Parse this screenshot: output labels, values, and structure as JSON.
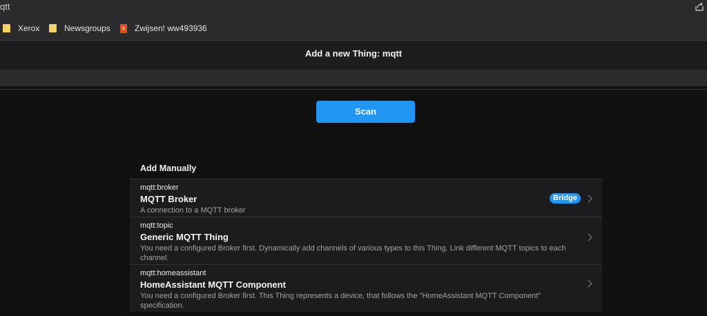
{
  "browser": {
    "url_text": "qtt",
    "share_icon": "share-icon",
    "bookmarks": [
      {
        "label": "Xerox",
        "icon": "folder-icon"
      },
      {
        "label": "Newsgroups",
        "icon": "folder-icon"
      },
      {
        "label": "Zwijsen! ww493936",
        "icon": "zwijsen-favicon"
      }
    ]
  },
  "page": {
    "title": "Add a new Thing: mqtt",
    "scan_label": "Scan",
    "section_title": "Add Manually"
  },
  "things": [
    {
      "id": "mqtt:broker",
      "name": "MQTT Broker",
      "description": "A connection to a MQTT broker",
      "badge": "Bridge"
    },
    {
      "id": "mqtt:topic",
      "name": "Generic MQTT Thing",
      "description": "You need a configured Broker first. Dynamically add channels of various types to this Thing. Link different MQTT topics to each channel."
    },
    {
      "id": "mqtt:homeassistant",
      "name": "HomeAssistant MQTT Component",
      "description": "You need a configured Broker first. This Thing represents a device, that follows the \"HomeAssistant MQTT Component\" specification."
    }
  ],
  "colors": {
    "accent": "#2196f3",
    "background": "#111112",
    "panel": "#1c1c1e"
  }
}
